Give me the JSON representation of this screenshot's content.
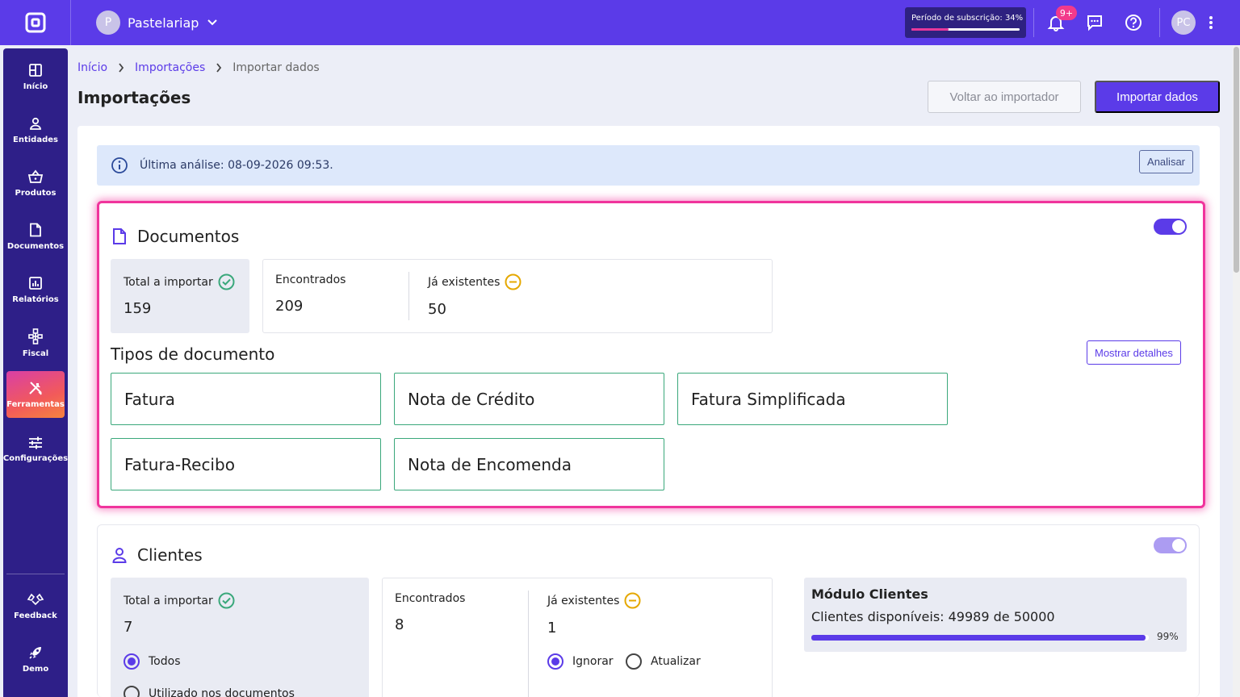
{
  "header": {
    "company_initial": "P",
    "company_name": "Pastelariap",
    "subscription_label": "Período de subscrição: 34%",
    "subscription_progress": 0.34,
    "notification_badge": "9+",
    "user_initials": "PC"
  },
  "sidebar": {
    "items": [
      {
        "label": "Início",
        "icon": "grid-icon"
      },
      {
        "label": "Entidades",
        "icon": "user-icon"
      },
      {
        "label": "Produtos",
        "icon": "basket-icon"
      },
      {
        "label": "Documentos",
        "icon": "document-icon"
      },
      {
        "label": "Relatórios",
        "icon": "chart-icon"
      },
      {
        "label": "Fiscal",
        "icon": "hierarchy-icon"
      },
      {
        "label": "Ferramentas",
        "icon": "tools-icon"
      },
      {
        "label": "Configurações",
        "icon": "sliders-icon"
      }
    ],
    "bottom_items": [
      {
        "label": "Feedback",
        "icon": "feedback-icon"
      },
      {
        "label": "Demo",
        "icon": "rocket-icon"
      }
    ]
  },
  "breadcrumb": {
    "home": "Início",
    "section": "Importações",
    "current": "Importar dados"
  },
  "page_title": "Importações",
  "buttons": {
    "back": "Voltar ao importador",
    "import": "Importar dados"
  },
  "info": {
    "text": "Última análise: 08-09-2026 09:53.",
    "analyze": "Analisar"
  },
  "documents": {
    "title": "Documentos",
    "total_label": "Total a importar",
    "total_value": "159",
    "found_label": "Encontrados",
    "found_value": "209",
    "existing_label": "Já existentes",
    "existing_value": "50",
    "types_title": "Tipos de documento",
    "details_button": "Mostrar detalhes",
    "types": [
      "Fatura",
      "Nota de Crédito",
      "Fatura Simplificada",
      "Fatura-Recibo",
      "Nota de Encomenda"
    ]
  },
  "clients": {
    "title": "Clientes",
    "total_label": "Total a importar",
    "total_value": "7",
    "found_label": "Encontrados",
    "found_value": "8",
    "existing_label": "Já existentes",
    "existing_value": "1",
    "filter_options": [
      "Todos",
      "Utilizado nos documentos"
    ],
    "existing_options": [
      "Ignorar",
      "Atualizar"
    ],
    "module_title": "Módulo Clientes",
    "module_text": "Clientes disponíveis: 49989 de 50000",
    "module_percent": "99%",
    "module_progress": 0.99
  },
  "colors": {
    "primary": "#5b3be8",
    "accent_pink": "#f0349c",
    "success": "#3aa87b",
    "warning": "#e5a800"
  }
}
